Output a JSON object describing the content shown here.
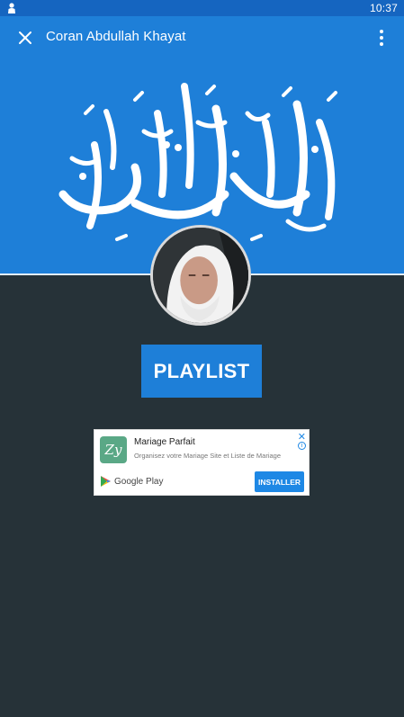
{
  "status_bar": {
    "time": "10:37",
    "notification_icon": "person-icon"
  },
  "app_bar": {
    "title": "Coran Abdullah Khayat",
    "close_icon": "close-icon",
    "menu_icon": "more-vert-icon"
  },
  "banner": {
    "calligraphy_text": "القرآن الكريم"
  },
  "main": {
    "playlist_label": "PLAYLIST"
  },
  "ad": {
    "logo_text": "Zy",
    "title": "Mariage Parfait",
    "description": "Organisez votre Mariage Site et Liste de Mariage",
    "store_label": "Google Play",
    "install_label": "INSTALLER",
    "close_glyph": "✕",
    "info_glyph": "i"
  },
  "colors": {
    "primary": "#1e7fd8",
    "status_bar": "#1565c0",
    "background": "#263238",
    "ad_accent": "#1e88e5"
  }
}
